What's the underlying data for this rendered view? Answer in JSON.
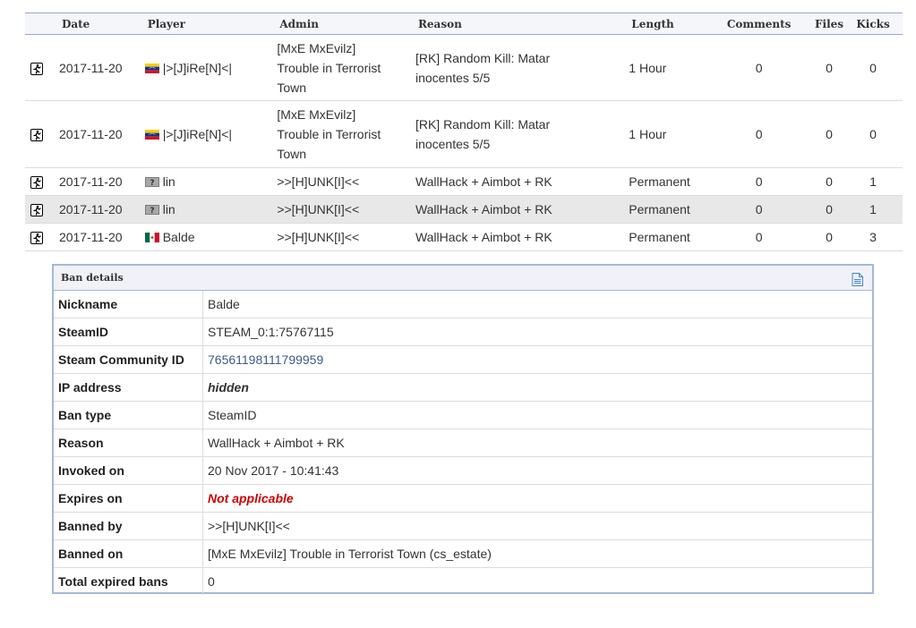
{
  "columns": {
    "date": "Date",
    "player": "Player",
    "admin": "Admin",
    "reason": "Reason",
    "length": "Length",
    "comments": "Comments",
    "files": "Files",
    "kicks": "Kicks"
  },
  "rows": [
    {
      "date": "2017-11-20",
      "player": "|>[J]iRe[N]<|",
      "player_flag": "ve",
      "admin_lines": [
        "[MxE MxEvilz]",
        "Trouble in Terrorist",
        "Town"
      ],
      "reason_lines": [
        "[RK] Random Kill: Matar",
        "inocentes 5/5"
      ],
      "length": "1 Hour",
      "comments": "0",
      "files": "0",
      "kicks": "0"
    },
    {
      "date": "2017-11-20",
      "player": "|>[J]iRe[N]<|",
      "player_flag": "ve",
      "admin_lines": [
        "[MxE MxEvilz]",
        "Trouble in Terrorist",
        "Town"
      ],
      "reason_lines": [
        "[RK] Random Kill: Matar",
        "inocentes 5/5"
      ],
      "length": "1 Hour",
      "comments": "0",
      "files": "0",
      "kicks": "0"
    },
    {
      "date": "2017-11-20",
      "player": "lin",
      "player_flag": "unknown",
      "admin_lines": [
        ">>[H]UNK[I]<<"
      ],
      "reason_lines": [
        "WallHack + Aimbot + RK"
      ],
      "length": "Permanent",
      "comments": "0",
      "files": "0",
      "kicks": "1"
    },
    {
      "date": "2017-11-20",
      "player": "lin",
      "player_flag": "unknown",
      "admin_lines": [
        ">>[H]UNK[I]<<"
      ],
      "reason_lines": [
        "WallHack + Aimbot + RK"
      ],
      "length": "Permanent",
      "comments": "0",
      "files": "0",
      "kicks": "1",
      "highlighted": true
    },
    {
      "date": "2017-11-20",
      "player": "Balde",
      "player_flag": "mx",
      "admin_lines": [
        ">>[H]UNK[I]<<"
      ],
      "reason_lines": [
        "WallHack + Aimbot + RK"
      ],
      "length": "Permanent",
      "comments": "0",
      "files": "0",
      "kicks": "3"
    }
  ],
  "details": {
    "title": "Ban details",
    "nickname_label": "Nickname",
    "nickname": "Balde",
    "steamid_label": "SteamID",
    "steamid": "STEAM_0:1:75767115",
    "community_label": "Steam Community ID",
    "community": "76561198111799959",
    "ip_label": "IP address",
    "ip": "hidden",
    "bantype_label": "Ban type",
    "bantype": "SteamID",
    "reason_label": "Reason",
    "reason": "WallHack + Aimbot + RK",
    "invoked_label": "Invoked on",
    "invoked": "20 Nov 2017 - 10:41:43",
    "expires_label": "Expires on",
    "expires": "Not applicable",
    "bannedby_label": "Banned by",
    "bannedby": ">>[H]UNK[I]<<",
    "bannedon_label": "Banned on",
    "bannedon": "[MxE MxEvilz] Trouble in Terrorist Town (cs_estate)",
    "expired_label": "Total expired bans",
    "expired": "0"
  },
  "colors": {
    "header_border": "#98a9c8",
    "panel_border": "#a6b8d4",
    "link": "#3a5b8a",
    "alert": "#cc0000",
    "row_highlight": "#e8e8e8"
  }
}
